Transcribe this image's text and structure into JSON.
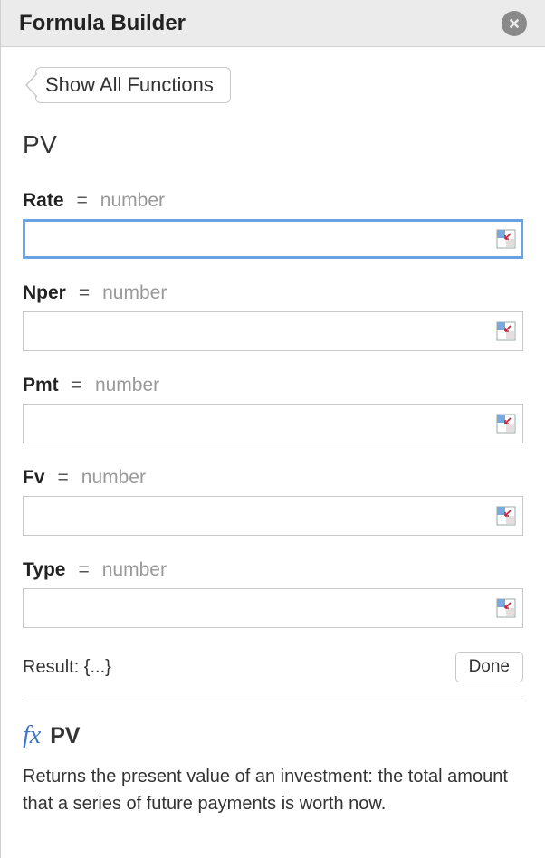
{
  "header": {
    "title": "Formula Builder"
  },
  "breadcrumb": {
    "label": "Show All Functions"
  },
  "function": {
    "name": "PV"
  },
  "args": [
    {
      "name": "Rate",
      "eq": "=",
      "type": "number",
      "value": "",
      "focused": true
    },
    {
      "name": "Nper",
      "eq": "=",
      "type": "number",
      "value": "",
      "focused": false
    },
    {
      "name": "Pmt",
      "eq": "=",
      "type": "number",
      "value": "",
      "focused": false
    },
    {
      "name": "Fv",
      "eq": "=",
      "type": "number",
      "value": "",
      "focused": false
    },
    {
      "name": "Type",
      "eq": "=",
      "type": "number",
      "value": "",
      "focused": false
    }
  ],
  "result": {
    "label": "Result: {...}",
    "done": "Done"
  },
  "description": {
    "fx": "fx",
    "name": "PV",
    "text": "Returns the present value of an investment: the total amount that a series of future payments is worth now."
  }
}
